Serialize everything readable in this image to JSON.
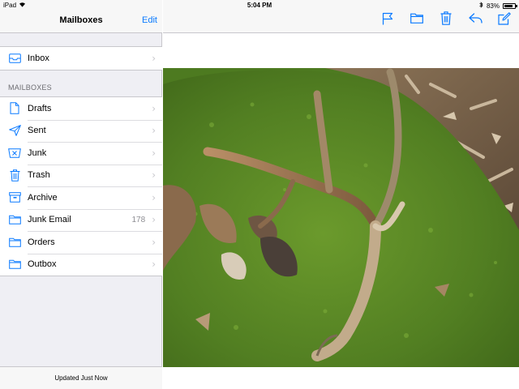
{
  "status_bar": {
    "device": "iPad",
    "time": "5:04 PM",
    "battery": "83%",
    "battery_level": 0.83
  },
  "sidebar": {
    "title": "Mailboxes",
    "edit_label": "Edit",
    "inbox": {
      "label": "Inbox",
      "icon": "inbox-tray-icon"
    },
    "section_header": "MAILBOXES",
    "items": [
      {
        "label": "Drafts",
        "icon": "draft-document-icon",
        "count": ""
      },
      {
        "label": "Sent",
        "icon": "paper-plane-icon",
        "count": ""
      },
      {
        "label": "Junk",
        "icon": "junk-bin-icon",
        "count": ""
      },
      {
        "label": "Trash",
        "icon": "trash-icon",
        "count": ""
      },
      {
        "label": "Archive",
        "icon": "archive-box-icon",
        "count": ""
      },
      {
        "label": "Junk Email",
        "icon": "folder-icon",
        "count": "178"
      },
      {
        "label": "Orders",
        "icon": "folder-icon",
        "count": ""
      },
      {
        "label": "Outbox",
        "icon": "folder-icon",
        "count": ""
      }
    ],
    "footer": "Updated Just Now"
  },
  "toolbar": {
    "buttons": [
      {
        "name": "flag-button",
        "icon": "flag-icon"
      },
      {
        "name": "move-folder-button",
        "icon": "folder-icon"
      },
      {
        "name": "trash-button",
        "icon": "trash-icon"
      },
      {
        "name": "reply-button",
        "icon": "reply-arrow-icon"
      },
      {
        "name": "compose-button",
        "icon": "compose-icon"
      }
    ]
  },
  "colors": {
    "accent": "#0a7aff",
    "moss": "#5f8f2a",
    "antler": "#a07a55"
  }
}
